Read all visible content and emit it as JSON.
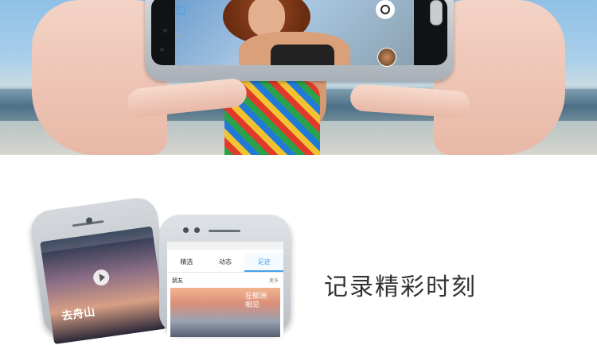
{
  "banner": {
    "camera_shutter_icon": "camera-shutter-icon",
    "gallery_thumb_icon": "gallery-thumbnail-icon"
  },
  "phone_left": {
    "caption": "去舟山",
    "play_icon": "play-icon"
  },
  "phone_right": {
    "tabs": [
      {
        "label": "精选"
      },
      {
        "label": "动态"
      },
      {
        "label": "足迹"
      }
    ],
    "subheading": "朋友",
    "subheading_right": "更多",
    "photo_text_line1": "在郁洲",
    "photo_text_line2": "相见"
  },
  "headline": "记录精彩时刻",
  "colors": {
    "accent": "#4aa0e8",
    "headline": "#333333"
  }
}
